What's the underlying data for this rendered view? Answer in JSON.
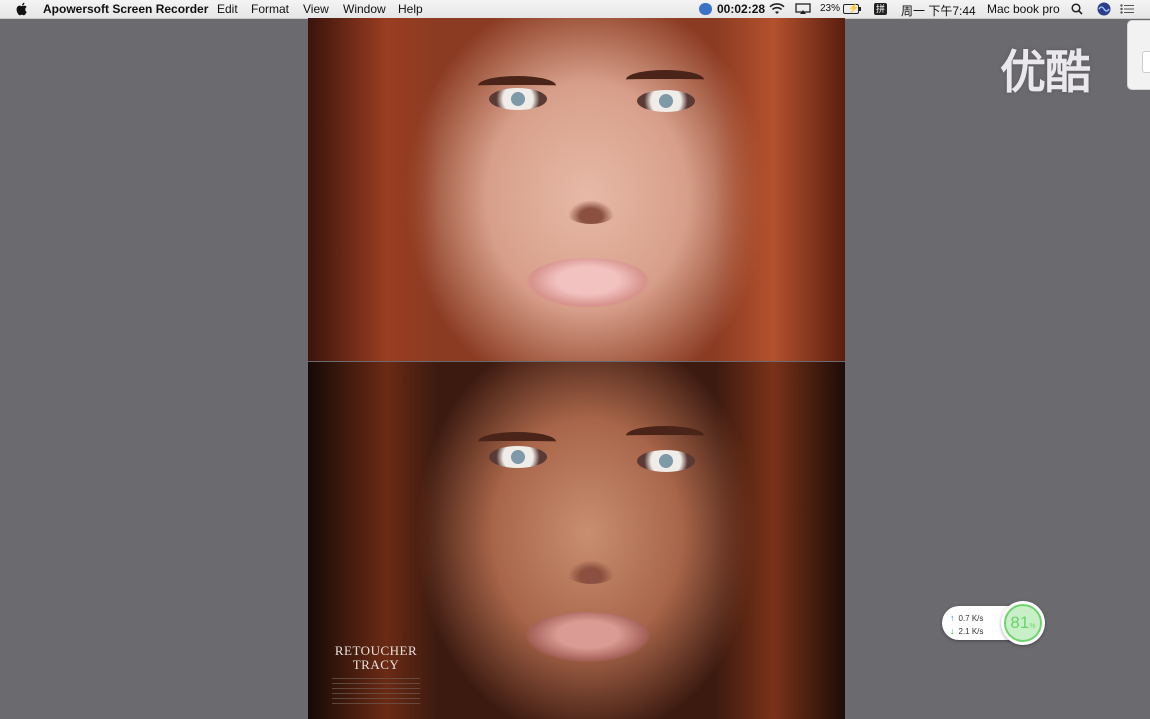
{
  "menubar": {
    "app_name": "Apowersoft Screen Recorder",
    "menus": [
      "Edit",
      "Format",
      "View",
      "Window",
      "Help"
    ],
    "timer": "00:02:28",
    "battery": "23%",
    "ime": "拼",
    "datetime": "周一 下午7:44",
    "computer_name": "Mac book pro"
  },
  "caption": {
    "line1": "RETOUCHER",
    "line2": "TRACY"
  },
  "watermark": "优酷",
  "network": {
    "up": "0.7 K/s",
    "down": "2.1 K/s",
    "percent": "81",
    "percent_unit": "%"
  },
  "icons": [
    "apple-icon",
    "recording-icon",
    "wifi-icon",
    "airplay-icon",
    "battery-icon",
    "ime-icon",
    "search-icon",
    "siri-icon",
    "notification-list-icon",
    "upload-arrow-icon",
    "download-arrow-icon"
  ],
  "colors": {
    "desktop": "#6b6a6e",
    "menubar": "#eeeeee",
    "gauge": "#6ed46e"
  }
}
